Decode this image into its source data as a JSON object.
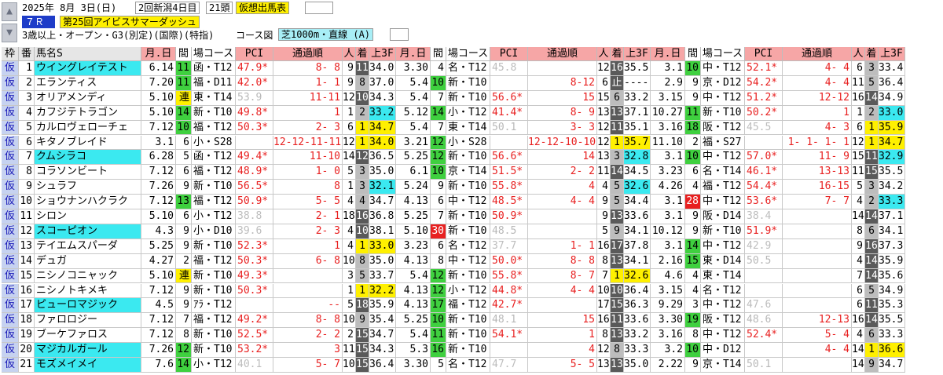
{
  "header": {
    "nav_up": "▲",
    "nav_down": "▼",
    "date": "2025年 8月 3日(日)",
    "venue": "2回新潟4日目",
    "heads": "21頭",
    "mode": "仮想出馬表",
    "race_no": "７Ｒ",
    "race_name": "第25回アイビスサマーダッシュ",
    "conditions": "3歳以上・オープン・G3(別定)(国際)(特指)",
    "course_label": "コース図",
    "course": "芝1000m・直線 (A)"
  },
  "colors": {
    "pink": "#f6a6a6",
    "lightpink": "#f8c0c0",
    "green": "#3fd03f",
    "yellow": "#fff000",
    "cyan": "#3be9f0",
    "red": "#e82020",
    "gray": "#bdbdbd",
    "darkgray": "#5a5a5a",
    "black": "#000000"
  },
  "columns": [
    "枠",
    "番",
    "馬名S",
    "月.日",
    "間",
    "場コース",
    "PCI",
    "通過順",
    "人",
    "着",
    "上3F",
    "月.日",
    "間",
    "場コース",
    "PCI",
    "通過順",
    "人",
    "着",
    "上3F",
    "月.日",
    "間",
    "場コース",
    "PCI",
    "通過順",
    "人",
    "着",
    "上3F"
  ],
  "rows": [
    {
      "waku": "仮",
      "no": "1",
      "name": "ウイングレイテスト",
      "hi": true,
      "hn": true,
      "r": [
        [
          "6.14",
          "11",
          "函・T12",
          "47.9*",
          "8- 8",
          "9",
          "11",
          "34.0"
        ],
        [
          "3.30",
          "4",
          "名・T12",
          "45.8",
          "",
          "12",
          "16",
          "35.5"
        ],
        [
          "3.1",
          "10",
          "中・T12",
          "52.1*",
          "4- 4",
          "6",
          "3",
          "33.4"
        ]
      ]
    },
    {
      "waku": "仮",
      "no": "2",
      "name": "エランティス",
      "hi": false,
      "hn": false,
      "r": [
        [
          "7.20",
          "11",
          "福・D11",
          "42.0*",
          "1- 1",
          "9",
          "8",
          "37.0"
        ],
        [
          "5.4",
          "10",
          "新・T10",
          "",
          "8-12",
          "6",
          "止",
          "----"
        ],
        [
          "2.9",
          "9",
          "京・D12",
          "54.2*",
          "4- 4",
          "11",
          "5",
          "36.4"
        ]
      ]
    },
    {
      "waku": "仮",
      "no": "3",
      "name": "オリアメンディ",
      "hi": false,
      "hn": false,
      "r": [
        [
          "5.10",
          "連",
          "東・T14",
          "53.9",
          "11-11",
          "12",
          "10",
          "34.3"
        ],
        [
          "5.4",
          "7",
          "新・T10",
          "56.6*",
          "15",
          "15",
          "6",
          "33.2"
        ],
        [
          "3.15",
          "9",
          "中・T12",
          "51.2*",
          "12-12",
          "16",
          "14",
          "34.9"
        ]
      ]
    },
    {
      "waku": "仮",
      "no": "4",
      "name": "カフジテトラゴン",
      "hi": false,
      "hn": false,
      "r": [
        [
          "5.10",
          "14",
          "新・T10",
          "49.8*",
          "1",
          "1",
          "2",
          "33.2"
        ],
        [
          "5.12",
          "14",
          "小・T12",
          "41.4*",
          "8- 9",
          "13",
          "13",
          "37.1"
        ],
        [
          "10.27",
          "11",
          "新・T10",
          "50.2*",
          "1",
          "1",
          "2",
          "33.0"
        ]
      ]
    },
    {
      "waku": "仮",
      "no": "5",
      "name": "カルロヴェローチェ",
      "hi": false,
      "hn": false,
      "r": [
        [
          "7.12",
          "10",
          "福・T12",
          "50.3*",
          "2- 3",
          "6",
          "1",
          "34.7"
        ],
        [
          "5.4",
          "7",
          "東・T14",
          "50.1",
          "3- 3",
          "12",
          "11",
          "35.1"
        ],
        [
          "3.16",
          "18",
          "阪・T12",
          "45.5",
          "4- 3",
          "6",
          "1",
          "35.9"
        ]
      ]
    },
    {
      "waku": "仮",
      "no": "6",
      "name": "キタノブレイド",
      "hi": false,
      "hn": false,
      "r": [
        [
          "3.1",
          "6",
          "小・S28",
          "",
          "12-12-11-11",
          "12",
          "1",
          "34.0"
        ],
        [
          "3.21",
          "12",
          "小・S28",
          "",
          "12-12-10-10",
          "12",
          "1",
          "35.7"
        ],
        [
          "11.10",
          "2",
          "福・S27",
          "",
          "1- 1- 1- 1",
          "12",
          "1",
          "34.7"
        ]
      ]
    },
    {
      "waku": "仮",
      "no": "7",
      "name": "クムシラコ",
      "hi": false,
      "hn": true,
      "r": [
        [
          "6.28",
          "5",
          "函・T12",
          "49.4*",
          "11-10",
          "14",
          "12",
          "36.5"
        ],
        [
          "5.25",
          "12",
          "新・T10",
          "56.6*",
          "14",
          "13",
          "3",
          "32.8"
        ],
        [
          "3.1",
          "10",
          "中・T12",
          "57.0*",
          "11- 9",
          "15",
          "11",
          "32.9"
        ]
      ]
    },
    {
      "waku": "仮",
      "no": "8",
      "name": "コラソンビート",
      "hi": false,
      "hn": false,
      "r": [
        [
          "7.12",
          "6",
          "福・T12",
          "48.9*",
          "1- 0",
          "5",
          "3",
          "35.0"
        ],
        [
          "6.1",
          "10",
          "京・T14",
          "51.5*",
          "2- 2",
          "11",
          "14",
          "34.5"
        ],
        [
          "3.23",
          "6",
          "名・T14",
          "46.1*",
          "13-13",
          "11",
          "15",
          "35.5"
        ]
      ]
    },
    {
      "waku": "仮",
      "no": "9",
      "name": "シュラフ",
      "hi": false,
      "hn": false,
      "r": [
        [
          "7.26",
          "9",
          "新・T10",
          "56.5*",
          "8",
          "1",
          "3",
          "32.1"
        ],
        [
          "5.24",
          "9",
          "新・T10",
          "55.8*",
          "4",
          "4",
          "5",
          "32.6"
        ],
        [
          "4.26",
          "4",
          "福・T12",
          "54.4*",
          "16-15",
          "5",
          "3",
          "34.2"
        ]
      ]
    },
    {
      "waku": "仮",
      "no": "10",
      "name": "ショウナンハクラク",
      "hi": false,
      "hn": false,
      "r": [
        [
          "7.12",
          "13",
          "福・T12",
          "50.9*",
          "5- 5",
          "4",
          "4",
          "34.7"
        ],
        [
          "4.13",
          "6",
          "中・T12",
          "48.5*",
          "4- 4",
          "9",
          "5",
          "34.4"
        ],
        [
          "3.1",
          "28",
          "中・T12",
          "53.6*",
          "7- 7",
          "4",
          "2",
          "33.3"
        ]
      ]
    },
    {
      "waku": "仮",
      "no": "11",
      "name": "シロン",
      "hi": false,
      "hn": false,
      "r": [
        [
          "5.10",
          "6",
          "小・T12",
          "38.8",
          "2- 1",
          "18",
          "16",
          "36.8"
        ],
        [
          "5.25",
          "7",
          "新・T10",
          "50.9*",
          "",
          "9",
          "13",
          "33.6"
        ],
        [
          "3.1",
          "9",
          "阪・D14",
          "38.4",
          "",
          "14",
          "14",
          "37.1"
        ]
      ]
    },
    {
      "waku": "仮",
      "no": "12",
      "name": "スコーピオン",
      "hi": false,
      "hn": true,
      "r": [
        [
          "4.3",
          "9",
          "小・D10",
          "39.6",
          "2- 3",
          "4",
          "10",
          "38.1"
        ],
        [
          "5.10",
          "30",
          "新・T10",
          "48.5",
          "",
          "5",
          "9",
          "34.1"
        ],
        [
          "10.12",
          "9",
          "新・T10",
          "51.9*",
          "",
          "8",
          "6",
          "34.1"
        ]
      ]
    },
    {
      "waku": "仮",
      "no": "13",
      "name": "テイエムスパーダ",
      "hi": false,
      "hn": false,
      "r": [
        [
          "5.25",
          "9",
          "新・T10",
          "52.3*",
          "1",
          "4",
          "1",
          "33.0"
        ],
        [
          "3.23",
          "6",
          "名・T12",
          "37.7",
          "1- 1",
          "16",
          "17",
          "37.8"
        ],
        [
          "3.1",
          "14",
          "中・T12",
          "42.9",
          "",
          "9",
          "16",
          "37.3"
        ]
      ]
    },
    {
      "waku": "仮",
      "no": "14",
      "name": "デュガ",
      "hi": false,
      "hn": false,
      "r": [
        [
          "4.27",
          "2",
          "福・T12",
          "50.3*",
          "6- 8",
          "10",
          "8",
          "35.0"
        ],
        [
          "4.13",
          "8",
          "中・T12",
          "50.0*",
          "8- 8",
          "8",
          "13",
          "34.1"
        ],
        [
          "2.16",
          "15",
          "東・D14",
          "50.5",
          "",
          "4",
          "14",
          "35.9"
        ]
      ]
    },
    {
      "waku": "仮",
      "no": "15",
      "name": "ニシノコニャック",
      "hi": false,
      "hn": false,
      "r": [
        [
          "5.10",
          "連",
          "新・T10",
          "49.3*",
          "",
          "3",
          "5",
          "33.7"
        ],
        [
          "5.4",
          "12",
          "新・T10",
          "55.8*",
          "8- 7",
          "7",
          "1",
          "32.6"
        ],
        [
          "4.6",
          "4",
          "東・T14",
          "",
          "",
          "7",
          "14",
          "35.6"
        ]
      ]
    },
    {
      "waku": "仮",
      "no": "16",
      "name": "ニシノトキメキ",
      "hi": false,
      "hn": false,
      "r": [
        [
          "7.12",
          "9",
          "新・T10",
          "50.3*",
          "",
          "1",
          "1",
          "32.2"
        ],
        [
          "4.13",
          "12",
          "小・T12",
          "44.8*",
          "4- 4",
          "10",
          "10",
          "36.4"
        ],
        [
          "3.15",
          "4",
          "名・T12",
          "",
          "",
          "6",
          "5",
          "34.9"
        ]
      ]
    },
    {
      "waku": "仮",
      "no": "17",
      "name": "ピューロマジック",
      "hi": false,
      "hn": true,
      "r": [
        [
          "4.5",
          "9",
          "ｱﾗ・T12",
          "",
          "--",
          "5",
          "18",
          "35.9"
        ],
        [
          "4.13",
          "17",
          "福・T12",
          "42.7*",
          "",
          "17",
          "15",
          "36.3"
        ],
        [
          "9.29",
          "3",
          "中・T12",
          "47.6",
          "",
          "6",
          "11",
          "35.3"
        ]
      ]
    },
    {
      "waku": "仮",
      "no": "18",
      "name": "ファロロジー",
      "hi": false,
      "hn": false,
      "r": [
        [
          "7.12",
          "7",
          "福・T12",
          "49.2*",
          "8- 8",
          "10",
          "9",
          "35.4"
        ],
        [
          "5.25",
          "10",
          "新・T10",
          "48.1",
          "15",
          "16",
          "11",
          "33.6"
        ],
        [
          "3.30",
          "19",
          "阪・T12",
          "48.6",
          "12-13",
          "16",
          "14",
          "35.5"
        ]
      ]
    },
    {
      "waku": "仮",
      "no": "19",
      "name": "ブーケファロス",
      "hi": false,
      "hn": false,
      "r": [
        [
          "7.12",
          "8",
          "新・T10",
          "52.5*",
          "2- 2",
          "2",
          "15",
          "34.7"
        ],
        [
          "5.4",
          "11",
          "新・T10",
          "54.1*",
          "1",
          "8",
          "13",
          "33.2"
        ],
        [
          "3.16",
          "8",
          "中・T12",
          "52.4*",
          "5- 4",
          "4",
          "6",
          "33.3"
        ]
      ]
    },
    {
      "waku": "仮",
      "no": "20",
      "name": "マジカルガール",
      "hi": false,
      "hn": true,
      "r": [
        [
          "7.26",
          "12",
          "新・T10",
          "53.2*",
          "3",
          "11",
          "15",
          "34.3"
        ],
        [
          "5.3",
          "16",
          "新・T10",
          "",
          "4",
          "12",
          "8",
          "33.3"
        ],
        [
          "3.2",
          "10",
          "中・D12",
          "",
          "4- 4",
          "14",
          "1",
          "36.6"
        ]
      ]
    },
    {
      "waku": "仮",
      "no": "21",
      "name": "モズメイメイ",
      "hi": false,
      "hn": true,
      "r": [
        [
          "7.6",
          "14",
          "小・T12",
          "40.1",
          "5- 7",
          "10",
          "15",
          "36.4"
        ],
        [
          "3.30",
          "5",
          "名・T12",
          "47.7",
          "5- 5",
          "13",
          "13",
          "35.0"
        ],
        [
          "2.22",
          "9",
          "京・T14",
          "50.1",
          "",
          "14",
          "9",
          "34.7"
        ]
      ]
    }
  ]
}
